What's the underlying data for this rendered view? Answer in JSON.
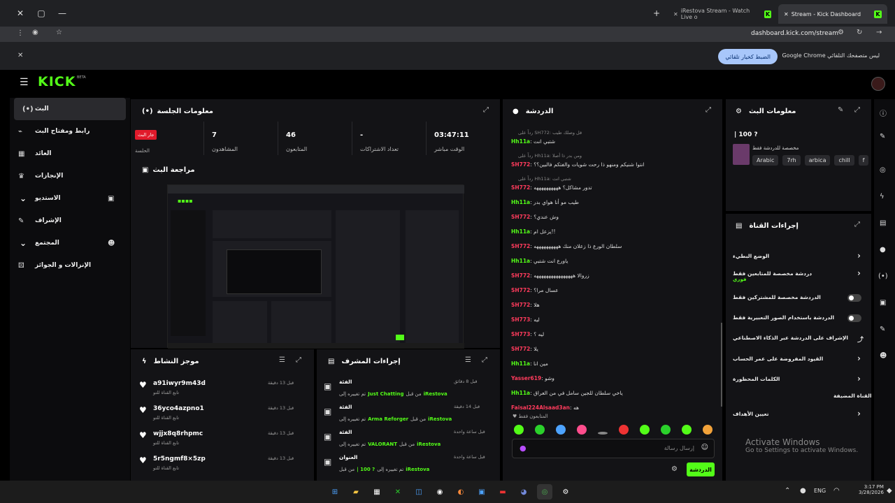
{
  "browser": {
    "tabs": [
      {
        "title": "iRestova Stream - Watch Live o"
      },
      {
        "title": "Stream - Kick Dashboard"
      }
    ],
    "url": "dashboard.kick.com/stream",
    "infobar_msg": "Google Chrome ليس متصفحك التلقائي",
    "infobar_btn": "الضبط كخيار تلقائي"
  },
  "app": {
    "logo": "KICK",
    "beta": "BETA"
  },
  "sidebar": {
    "items": [
      {
        "label": "البث",
        "icon": "(•)"
      },
      {
        "label": "رابط ومفتاح البث",
        "icon": "⌁"
      },
      {
        "label": "العائد",
        "icon": "▦"
      },
      {
        "label": "الإنجازات",
        "icon": "♛"
      },
      {
        "label": "الاستديو",
        "icon": "▣"
      },
      {
        "label": "الإشراف",
        "icon": "✎"
      },
      {
        "label": "المجتمع",
        "icon": "☻"
      },
      {
        "label": "الإنزالات و الجوائز",
        "icon": "⚄"
      }
    ]
  },
  "session": {
    "title": "معلومات الجلسة",
    "badge": "جار البث",
    "badge_label": "الحلسة",
    "stats": [
      {
        "value": "7",
        "label": "المشاهدون"
      },
      {
        "value": "46",
        "label": "المتابعون"
      },
      {
        "value": "-",
        "label": "تعداد الاشتراكات"
      },
      {
        "value": "03:47:11",
        "label": "الوقت مباشر"
      }
    ]
  },
  "preview": {
    "title": "مراجعة البث"
  },
  "activity": {
    "title": "موجز النشاط",
    "items": [
      {
        "user": "a91iwyr9m43d",
        "sub": "تابع القناة للتو",
        "time": "قبل 13 دقيقة"
      },
      {
        "user": "36yco4azpno1",
        "sub": "تابع القناة للتو",
        "time": "قبل 13 دقيقة"
      },
      {
        "user": "wjjx8q8rhpmc",
        "sub": "تابع القناة للتو",
        "time": "قبل 13 دقيقة"
      },
      {
        "user": "5r5ngmf8×5zp",
        "sub": "تابع القناة للتو",
        "time": "قبل 13 دقيقة"
      }
    ]
  },
  "modactions": {
    "title": "إجراءات المشرف",
    "items": [
      {
        "head": "الفئة",
        "time": "قبل 8 دقائق",
        "by": "iRestova",
        "text": "من قبل",
        "target": "Just Chatting",
        "suffix": "تم تغييره إلى"
      },
      {
        "head": "الفئة",
        "time": "قبل 14 دقيقة",
        "by": "iRestova",
        "text": "من قبل",
        "target": "Arma Reforger",
        "suffix": "تم تغييره إلى"
      },
      {
        "head": "الفئة",
        "time": "قبل ساعة واحدة",
        "by": "iRestova",
        "text": "من قبل",
        "target": "VALORANT",
        "suffix": "تم تغييره إلى"
      },
      {
        "head": "العنوان",
        "time": "قبل ساعة واحدة",
        "by": "iRestova",
        "text": "تم تغييره إلى",
        "target": "| 100 ?",
        "suffix": "من قبل"
      }
    ]
  },
  "chat": {
    "title": "الدردشة",
    "followers_only": "المتابعون فقط",
    "placeholder": "إرسال رسالة",
    "send": "الدردشة",
    "messages": [
      {
        "reply": "رداً على SH772: قل وصلك طيب",
        "user": "Hh11a",
        "color": "#53fc18",
        "text": "شتبي انت"
      },
      {
        "reply": "رداً على Hh11a: ومن بدر ذا أصلا",
        "user": "SH772",
        "color": "#ff3b5c",
        "text": "انتوا شنيكم ومنهو ذا رحت شويات والفتكم فالبين؟؟"
      },
      {
        "reply": "رداً على Hh11a: شتبي انت",
        "user": "SH772",
        "color": "#ff3b5c",
        "text": "تدور مشاكل؟ ههههههههههه"
      },
      {
        "reply": "",
        "user": "Hh11a",
        "color": "#53fc18",
        "text": "طيب مو أنا هواي بدر"
      },
      {
        "reply": "",
        "user": "SH772",
        "color": "#ff3b5c",
        "text": "وش عندي؟"
      },
      {
        "reply": "",
        "user": "Hh11a",
        "color": "#53fc18",
        "text": "يزعل ام!!"
      },
      {
        "reply": "",
        "user": "SH772",
        "color": "#ff3b5c",
        "text": "سلطان الورع ذا زعلان منك ههههههههههه"
      },
      {
        "reply": "",
        "user": "Hh11a",
        "color": "#53fc18",
        "text": "ياورع انت شتبي"
      },
      {
        "reply": "",
        "user": "SH772",
        "color": "#ff3b5c",
        "text": "زروالا ههههههههههههههههه"
      },
      {
        "reply": "",
        "user": "SH772",
        "color": "#ff3b5c",
        "text": "عسال مرا؟"
      },
      {
        "reply": "",
        "user": "SH772",
        "color": "#ff3b5c",
        "text": "هلا"
      },
      {
        "reply": "",
        "user": "SH773",
        "color": "#ff3b5c",
        "text": "ليه"
      },
      {
        "reply": "",
        "user": "SH773",
        "color": "#ff3b5c",
        "text": "ليه ؟"
      },
      {
        "reply": "",
        "user": "SH772",
        "color": "#ff3b5c",
        "text": "يلا"
      },
      {
        "reply": "",
        "user": "Hh11a",
        "color": "#53fc18",
        "text": "مين انا"
      },
      {
        "reply": "",
        "user": "Yasser619",
        "color": "#ff3b5c",
        "text": "وشو"
      },
      {
        "reply": "",
        "user": "Hh11a",
        "color": "#53fc18",
        "text": "ياخي سلطان للجين سامل في من العراق"
      },
      {
        "reply": "",
        "user": "Faisal224Alsaad3an",
        "color": "#ff3b5c",
        "text": "هه"
      }
    ]
  },
  "streaminfo": {
    "title": "معلومات البث",
    "stream_title": "| 100 ?",
    "category": "مخصصة للدردشة فقط",
    "tags": [
      "Arabic",
      "7rh",
      "arbica",
      "chill",
      "f"
    ]
  },
  "channel": {
    "title": "إجراءات القناة",
    "rows": [
      {
        "label": "الوضع البطيء",
        "kind": "chevron"
      },
      {
        "label": "دردشة مخصصة للمتابعين فقط",
        "sub": "فوري",
        "kind": "chevron"
      },
      {
        "label": "الدردشة مخصصة للمشتركين فقط",
        "kind": "toggle"
      },
      {
        "label": "الدردشة باستخدام الصور التعبيرية فقط",
        "kind": "toggle"
      },
      {
        "label": "الإشراف على الدردشة عبر الذكاء الاصطناعي",
        "kind": "link"
      },
      {
        "label": "القيود المفروضة على عمر الحساب",
        "kind": "chevron"
      },
      {
        "label": "الكلمات المحظورة",
        "kind": "chevron"
      },
      {
        "label": "القناة المضيفة",
        "kind": "none"
      },
      {
        "label": "تعيين الأهداف",
        "kind": "chevron"
      }
    ]
  },
  "watermark": {
    "line1": "Activate Windows",
    "line2": "Go to Settings to activate Windows."
  },
  "taskbar": {
    "lang": "ENG",
    "time": "3:17 PM",
    "date": "3/28/2026"
  },
  "colors": {
    "accent": "#53fc18",
    "panel": "#131316",
    "red": "#ff3b5c"
  }
}
